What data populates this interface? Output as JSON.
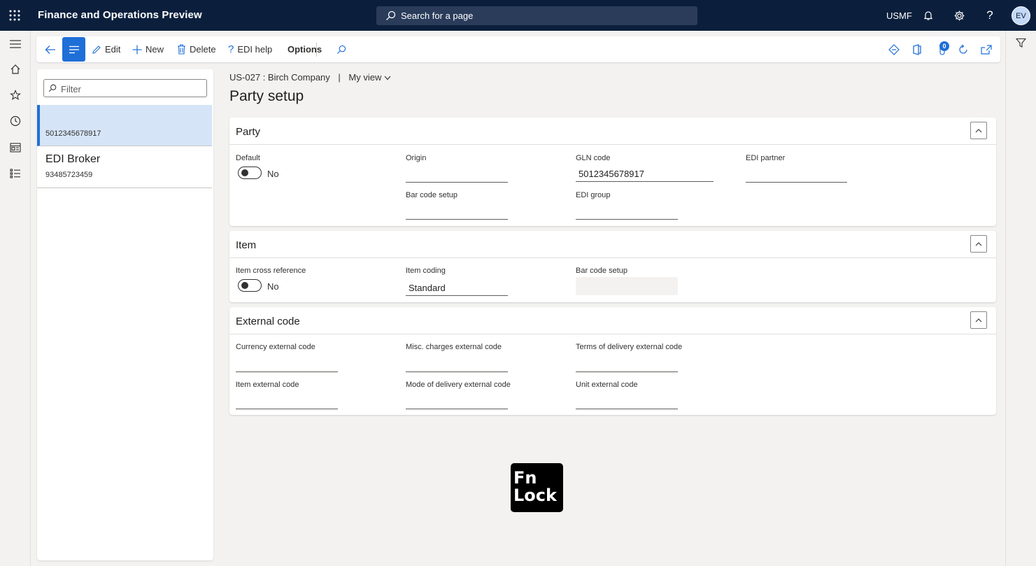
{
  "topbar": {
    "app_title": "Finance and Operations Preview",
    "search_placeholder": "Search for a page",
    "company": "USMF",
    "avatar_initials": "EV"
  },
  "actionpane": {
    "edit": "Edit",
    "new": "New",
    "delete": "Delete",
    "edi_help": "EDI help",
    "options": "Options",
    "notification_count": "0"
  },
  "list": {
    "filter_placeholder": "Filter",
    "items": [
      {
        "title": "",
        "subtitle": "5012345678917"
      },
      {
        "title": "EDI Broker",
        "subtitle": "93485723459"
      }
    ]
  },
  "content": {
    "breadcrumb_record": "US-027 : Birch Company",
    "breadcrumb_sep": "|",
    "view_label": "My view",
    "page_title": "Party setup"
  },
  "party": {
    "title": "Party",
    "default_label": "Default",
    "default_value": "No",
    "origin_label": "Origin",
    "origin_value": "",
    "gln_label": "GLN code",
    "gln_value": "5012345678917",
    "edi_partner_label": "EDI partner",
    "edi_partner_value": "",
    "bar_code_setup_label": "Bar code setup",
    "bar_code_setup_value": "",
    "edi_group_label": "EDI group",
    "edi_group_value": ""
  },
  "item": {
    "title": "Item",
    "cross_ref_label": "Item cross reference",
    "cross_ref_value": "No",
    "coding_label": "Item coding",
    "coding_value": "Standard",
    "bar_code_setup_label": "Bar code setup",
    "bar_code_setup_value": ""
  },
  "external": {
    "title": "External code",
    "currency_label": "Currency external code",
    "misc_label": "Misc. charges external code",
    "terms_label": "Terms of delivery external code",
    "item_label": "Item external code",
    "mode_label": "Mode of delivery external code",
    "unit_label": "Unit external code"
  },
  "overlay": {
    "fn": "Fn",
    "lock": "Lock"
  }
}
